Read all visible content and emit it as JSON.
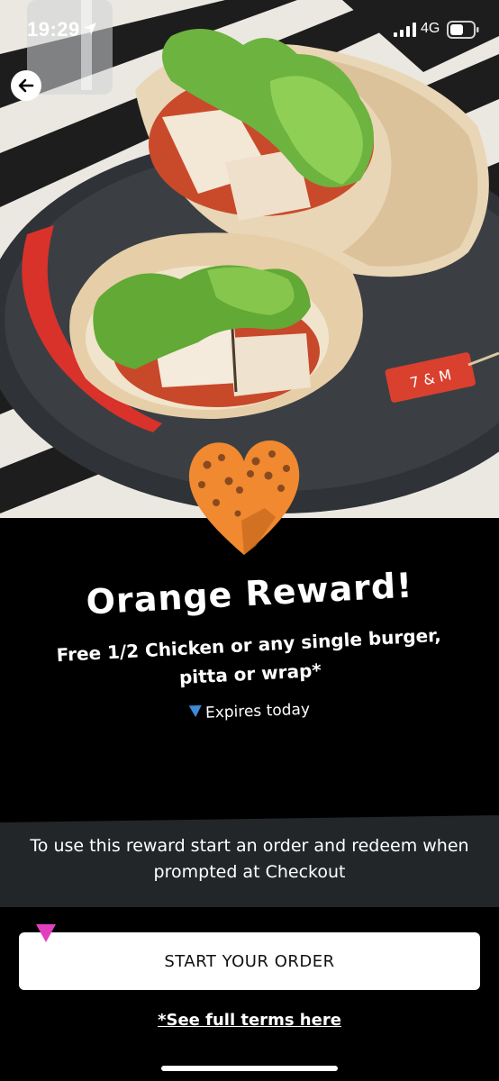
{
  "status_bar": {
    "time": "19:29",
    "network": "4G",
    "icons": [
      "location-arrow-icon",
      "signal-bars-icon",
      "battery-icon"
    ]
  },
  "navigation": {
    "back_icon": "back-arrow-icon"
  },
  "hero": {
    "badge_icon": "orange-heart-icon",
    "tag_text": "7 & M"
  },
  "reward": {
    "title": "Orange Reward!",
    "description": "Free 1/2 Chicken or any single burger, pitta or wrap*",
    "expiry": "Expires today"
  },
  "info": {
    "text": "To use this reward start an order and redeem when prompted at Checkout"
  },
  "actions": {
    "start_order_label": "START YOUR ORDER",
    "terms_label": "*See full terms here"
  },
  "colors": {
    "background": "#000000",
    "banner": "#232628",
    "heart": "#f0892f",
    "marker": "#e23fbf",
    "expiry_marker": "#3c8ad8"
  }
}
